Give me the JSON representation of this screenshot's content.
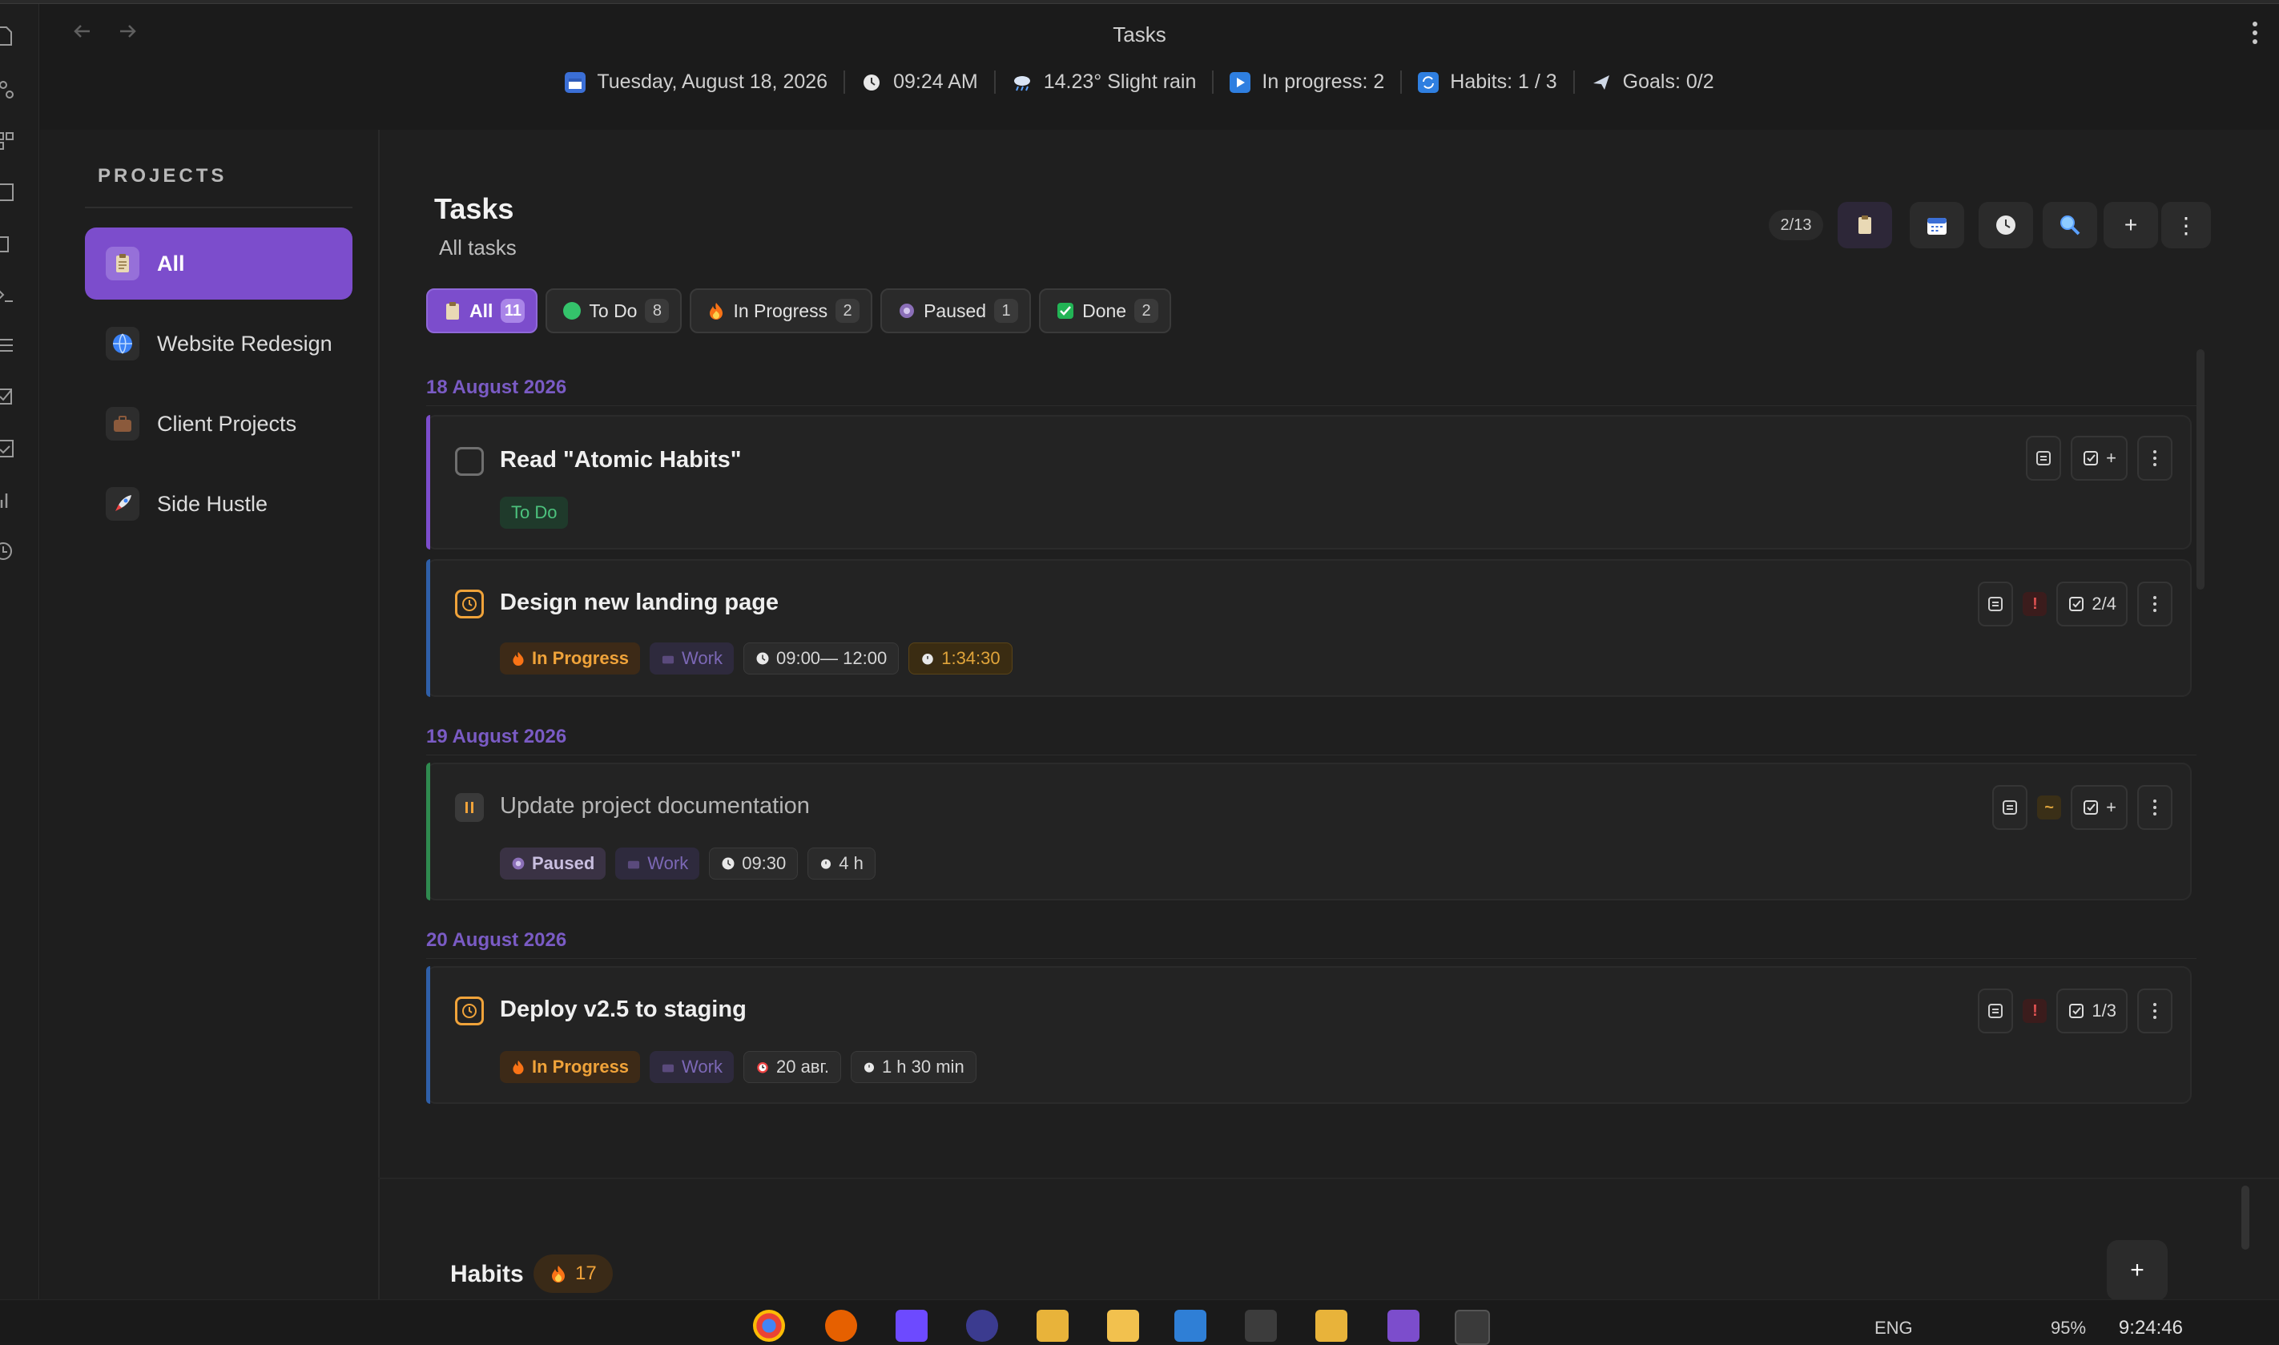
{
  "window": {
    "title": "Tasks"
  },
  "status_bar": {
    "date": "Tuesday, August 18, 2026",
    "time": "09:24 AM",
    "weather": "14.23° Slight rain",
    "in_progress": "In progress: 2",
    "habits": "Habits: 1 / 3",
    "goals": "Goals: 0/2"
  },
  "sidebar": {
    "title": "PROJECTS",
    "items": [
      {
        "label": "All",
        "icon": "clipboard-icon"
      },
      {
        "label": "Website Redesign",
        "icon": "globe-icon"
      },
      {
        "label": "Client Projects",
        "icon": "briefcase-icon"
      },
      {
        "label": "Side Hustle",
        "icon": "rocket-icon"
      }
    ]
  },
  "header": {
    "title": "Tasks",
    "subtitle": "All tasks",
    "count": "2/13",
    "add_label": "+",
    "more_label": "⋮"
  },
  "filters": [
    {
      "label": "All",
      "count": "11"
    },
    {
      "label": "To Do",
      "count": "8"
    },
    {
      "label": "In Progress",
      "count": "2"
    },
    {
      "label": "Paused",
      "count": "1"
    },
    {
      "label": "Done",
      "count": "2"
    }
  ],
  "groups": [
    {
      "date": "18 August 2026",
      "tasks": [
        {
          "title": "Read \"Atomic Habits\"",
          "status": "To Do",
          "subtasks": "+"
        },
        {
          "title": "Design new landing page",
          "status": "In Progress",
          "project": "Work",
          "time": "09:00— 12:00",
          "timer": "1:34:30",
          "priority": "!",
          "subtasks": "2/4"
        }
      ]
    },
    {
      "date": "19 August 2026",
      "tasks": [
        {
          "title": "Update project documentation",
          "status": "Paused",
          "project": "Work",
          "time": "09:30",
          "estimate": "4 h",
          "priority": "~",
          "subtasks": "+"
        }
      ]
    },
    {
      "date": "20 August 2026",
      "tasks": [
        {
          "title": "Deploy v2.5 to staging",
          "status": "In Progress",
          "project": "Work",
          "deadline": "20 авг.",
          "estimate": "1 h 30 min",
          "priority": "!",
          "subtasks": "1/3"
        }
      ]
    }
  ],
  "habits": {
    "title": "Habits",
    "streak": "17",
    "add_label": "+"
  },
  "taskbar": {
    "language": "ENG",
    "battery": "95%",
    "clock": "9:24:46"
  },
  "colors": {
    "accent": "#7c4dcc",
    "todo": "#4cc27d",
    "in_progress": "#f0a33a",
    "paused": "#2f8a4f",
    "date_header": "#7a5bc4"
  }
}
